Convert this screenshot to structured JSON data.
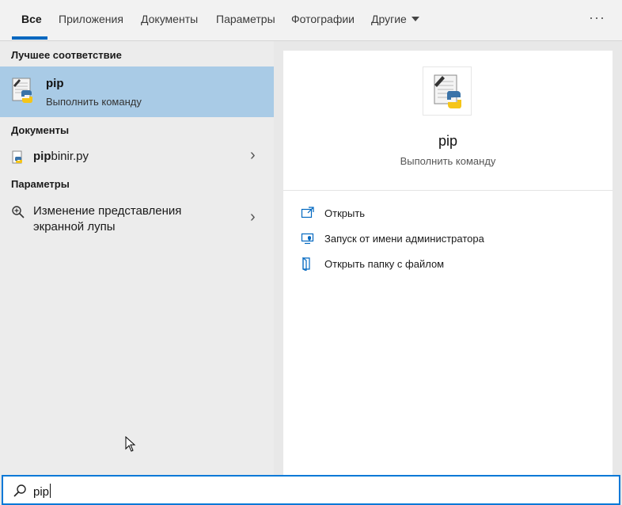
{
  "tabs": [
    {
      "label": "Все",
      "active": true
    },
    {
      "label": "Приложения"
    },
    {
      "label": "Документы"
    },
    {
      "label": "Параметры"
    },
    {
      "label": "Фотографии"
    },
    {
      "label": "Другие"
    }
  ],
  "more_menu": "···",
  "left": {
    "best_match_title": "Лучшее соответствие",
    "best_match": {
      "name": "pip",
      "subtitle": "Выполнить команду",
      "icon": "python-script-icon"
    },
    "documents_title": "Документы",
    "document": {
      "name_bold": "pip",
      "name_rest": "binir.py",
      "icon": "python-file-icon"
    },
    "settings_title": "Параметры",
    "setting": {
      "line1": "Изменение представления",
      "line2": "экранной лупы",
      "icon": "magnifier-icon"
    }
  },
  "preview": {
    "title": "pip",
    "subtitle": "Выполнить команду",
    "actions": [
      {
        "label": "Открыть",
        "icon": "open-icon"
      },
      {
        "label": "Запуск от имени администратора",
        "icon": "run-as-admin-icon"
      },
      {
        "label": "Открыть папку с файлом",
        "icon": "open-folder-icon"
      }
    ]
  },
  "search": {
    "query": "pip"
  },
  "colors": {
    "accent": "#0078d7",
    "selection": "#a9cbe6"
  }
}
